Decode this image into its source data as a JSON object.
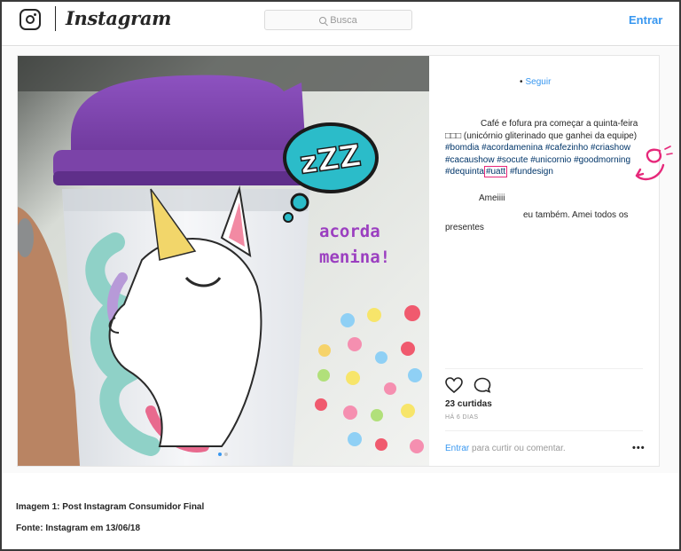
{
  "header": {
    "brand": "Instagram",
    "search_placeholder": "Busca",
    "login": "Entrar"
  },
  "post": {
    "follow_label": "Seguir",
    "follow_separator": "•",
    "caption": {
      "line_text": "Café e fofura pra começar a quinta-feira □□□ (unicórnio gliterinado que ganhei da equipe)",
      "hashtags_line1": "#bomdia #acordamenina",
      "hashtags_line2": "#cafezinho #criashow #cacaushow #socute",
      "hashtags_line3": "#unicornio #goodmorning #dequinta",
      "hashtag_highlighted": "#uatt",
      "hashtags_line4": "#fundesign"
    },
    "comments": [
      {
        "text": "Ameiiii"
      },
      {
        "text": "eu também. Amei todos os presentes"
      }
    ],
    "likes": "23 curtidas",
    "age": "HÁ 6 DIAS",
    "add_comment_link": "Entrar",
    "add_comment_text": "para curtir ou comentar.",
    "more_options": "•••",
    "photo": {
      "sticker_text": "zZZ",
      "overlay_line1": "acorda",
      "overlay_line2": "menina!"
    }
  },
  "icons": [
    "instagram-icon",
    "search-icon",
    "heart-icon",
    "comment-icon",
    "more-options-icon"
  ],
  "colors": {
    "link": "#3897f0",
    "text": "#262626",
    "muted": "#999999",
    "annotation": "#e6287a",
    "lid": "#7b43a8",
    "sticker": "#2bbcc9"
  },
  "footer": {
    "caption_title": "Imagem 1: Post Instagram Consumidor Final",
    "caption_source": "Fonte: Instagram em 13/06/18"
  }
}
